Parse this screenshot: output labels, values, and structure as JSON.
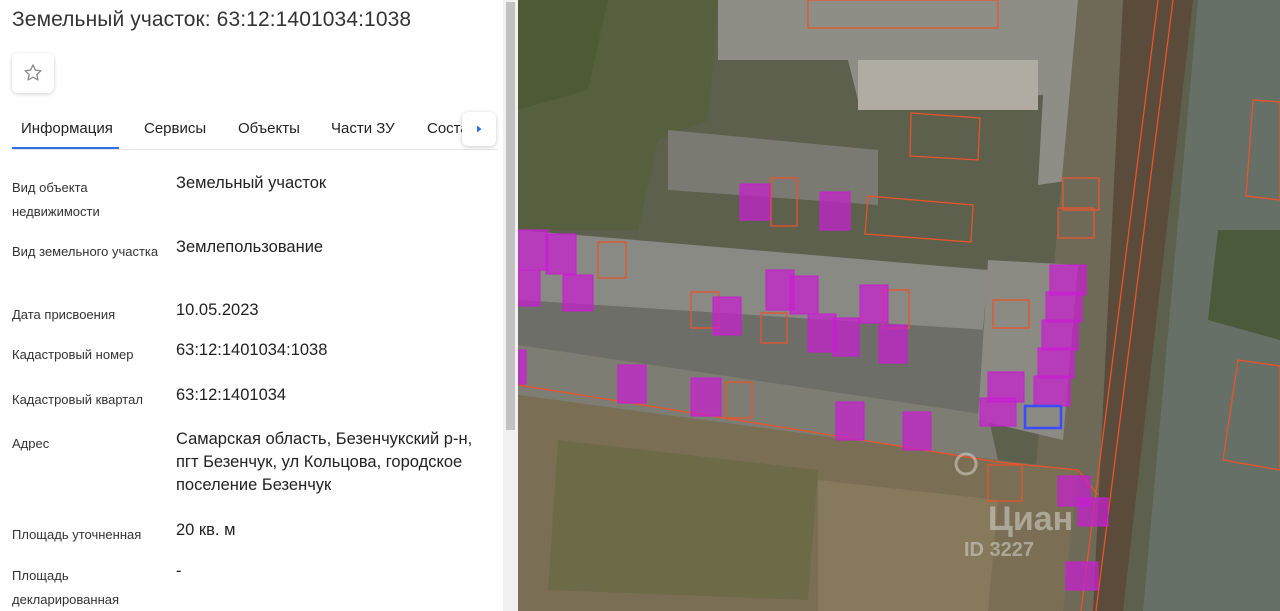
{
  "title": "Земельный участок: 63:12:1401034:1038",
  "tabs": [
    {
      "label": "Информация"
    },
    {
      "label": "Сервисы"
    },
    {
      "label": "Объекты"
    },
    {
      "label": "Части ЗУ"
    },
    {
      "label": "Состав ЕЗП"
    }
  ],
  "fields": [
    {
      "label": "Вид объекта недвижимости",
      "value": "Земельный участок"
    },
    {
      "label": "Вид земельного участка",
      "value": "Землепользование"
    },
    {
      "label": "Дата присвоения",
      "value": "10.05.2023"
    },
    {
      "label": "Кадастровый номер",
      "value": "63:12:1401034:1038"
    },
    {
      "label": "Кадастровый квартал",
      "value": "63:12:1401034"
    },
    {
      "label": "Адрес",
      "value": "Самарская область, Безенчукский р-н, пгт Безенчук, ул Кольцова, городское поселение Безенчук"
    },
    {
      "label": "Площадь уточненная",
      "value": "20 кв. м"
    },
    {
      "label": "Площадь декларированная",
      "value": "-"
    }
  ],
  "map": {
    "watermark": "Циан",
    "watermark_id": "ID 3227"
  },
  "colors": {
    "accent": "#2f6fe4",
    "parcel_fill": "#c71fd0",
    "parcel_border": "#e8542c",
    "selected_border": "#3b4bff"
  },
  "icons": [
    "star-icon",
    "chevron-right-icon"
  ]
}
